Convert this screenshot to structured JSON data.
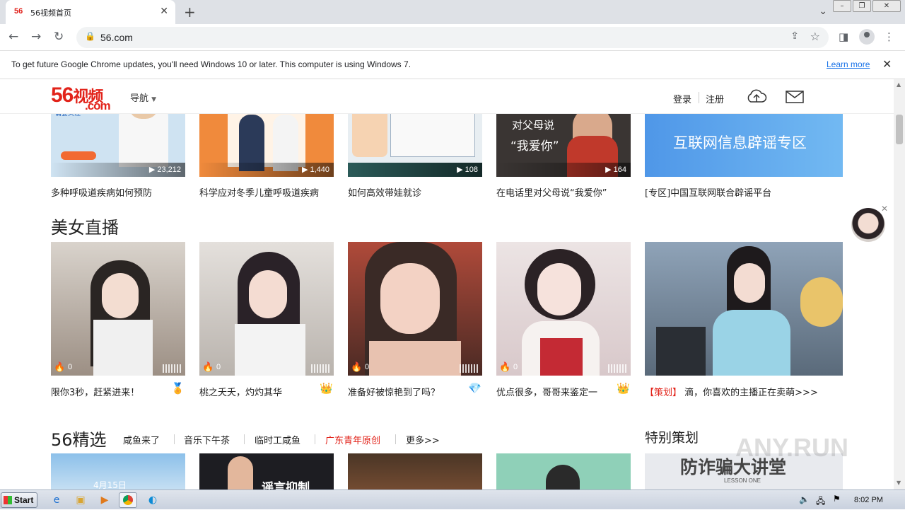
{
  "browser": {
    "tab_title": "56视频首页",
    "tab_favicon": "56",
    "url": "56.com",
    "infobar_message": "To get future Google Chrome updates, you'll need Windows 10 or later. This computer is using Windows 7.",
    "infobar_link": "Learn more"
  },
  "site": {
    "logo_number": "56",
    "logo_cn": "视频",
    "logo_domain": ".com",
    "nav_label": "导航",
    "login": "登录",
    "register": "注册"
  },
  "top_row": [
    {
      "caption": "多种呼吸道疾病如何预防",
      "count": "23,212",
      "color": "#cfe3f2"
    },
    {
      "caption": "科学应对冬季儿童呼吸道疾病",
      "count": "1,440",
      "color": "#f08a3c"
    },
    {
      "caption": "如何高效带娃就诊",
      "count": "108",
      "color": "#e8eef2"
    },
    {
      "caption": "在电话里对父母说“我爱你”",
      "count": "164",
      "color": "#3a3533"
    },
    {
      "caption": "[专区]中国互联网联合辟谣平台",
      "count": "",
      "color": "#5aa4ec"
    }
  ],
  "top_row_overlay_text": [
    "对父母说",
    "“我爱你”",
    "互联网信息辟谣专区"
  ],
  "live_section": {
    "title": "美女直播",
    "items": [
      {
        "caption": "限你3秒，赶紧进来！",
        "heat": "0",
        "badge": "🏅",
        "color": "#b8b0a8"
      },
      {
        "caption": "桃之夭夭，灼灼其华",
        "heat": "0",
        "badge": "👑",
        "color": "#c9c3bd"
      },
      {
        "caption": "准备好被惊艳到了吗？",
        "heat": "0",
        "badge": "💎",
        "color": "#8a5a4e"
      },
      {
        "caption": "优点很多，哥哥来鉴定一",
        "heat": "0",
        "badge": "👑",
        "color": "#e2d6d8"
      }
    ],
    "promo_tag": "【策划】",
    "promo_text": "滴，你喜欢的主播正在卖萌>>>",
    "promo_color": "#8aa0b8"
  },
  "featured": {
    "title": "56精选",
    "tabs": [
      "咸鱼来了",
      "音乐下午茶",
      "临时工咸鱼",
      "广东青年原创",
      "更多>>"
    ],
    "active_tab": "广东青年原创",
    "side_title": "特别策划",
    "side_banner_text": "防诈骗大讲堂",
    "side_banner_sub": "LESSON ONE",
    "thumb_texts": [
      "4月15日",
      "谣言抑制"
    ],
    "thumb_colors": [
      "#9ec9ea",
      "#1d1d22",
      "#5a3a28",
      "#8fd0b8"
    ]
  },
  "taskbar": {
    "start": "Start",
    "clock": "8:02 PM"
  },
  "watermark": "ANY.RUN"
}
